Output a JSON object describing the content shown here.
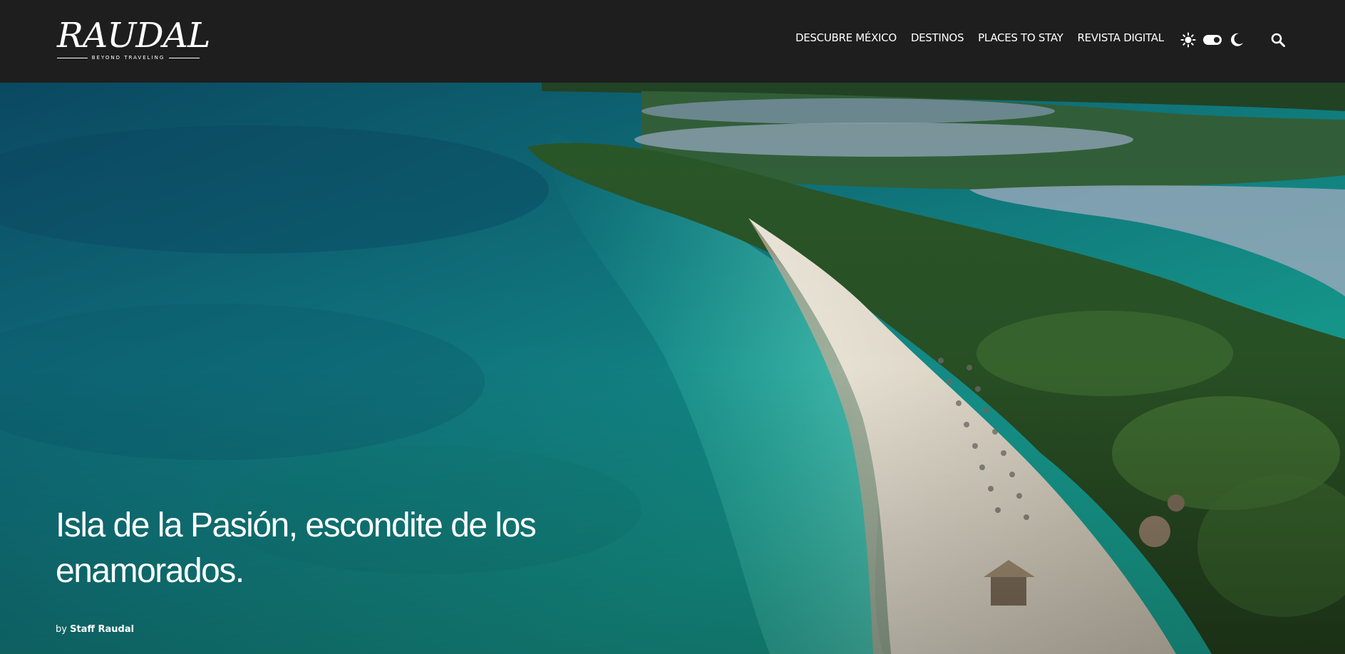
{
  "header": {
    "logo": {
      "word": "RAUDAL",
      "tagline": "BEYOND TRAVELING"
    },
    "nav": [
      {
        "label": "DESCUBRE MÉXICO"
      },
      {
        "label": "DESTINOS"
      },
      {
        "label": "PLACES TO STAY"
      },
      {
        "label": "REVISTA DIGITAL"
      }
    ],
    "icons": [
      "sun-icon",
      "toggle-switch",
      "moon-icon",
      "search-icon"
    ]
  },
  "hero": {
    "title": "Isla de la Pasión, escondite de los enamorados.",
    "byline": {
      "prefix": "by",
      "author": "Staff Raudal"
    }
  },
  "colors": {
    "header_bg": "#1e1e1e",
    "text": "#ffffff",
    "sea_deep": "#0b4f6b",
    "sea_turquoise": "#1a9b8c",
    "sand": "#d8d2c4",
    "vegetation": "#2f4f24"
  }
}
